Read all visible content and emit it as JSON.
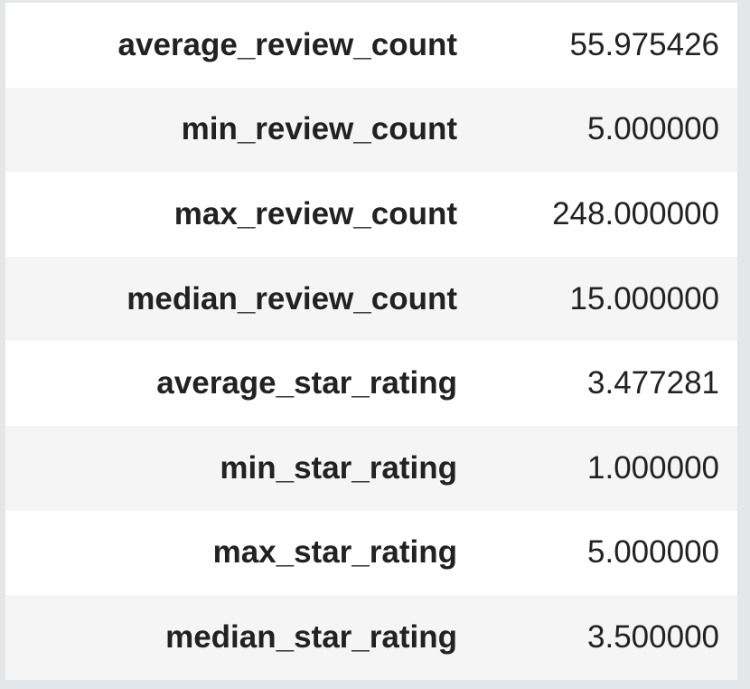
{
  "rows": [
    {
      "label": "average_review_count",
      "value": "55.975426"
    },
    {
      "label": "min_review_count",
      "value": "5.000000"
    },
    {
      "label": "max_review_count",
      "value": "248.000000"
    },
    {
      "label": "median_review_count",
      "value": "15.000000"
    },
    {
      "label": "average_star_rating",
      "value": "3.477281"
    },
    {
      "label": "min_star_rating",
      "value": "1.000000"
    },
    {
      "label": "max_star_rating",
      "value": "5.000000"
    },
    {
      "label": "median_star_rating",
      "value": "3.500000"
    }
  ]
}
